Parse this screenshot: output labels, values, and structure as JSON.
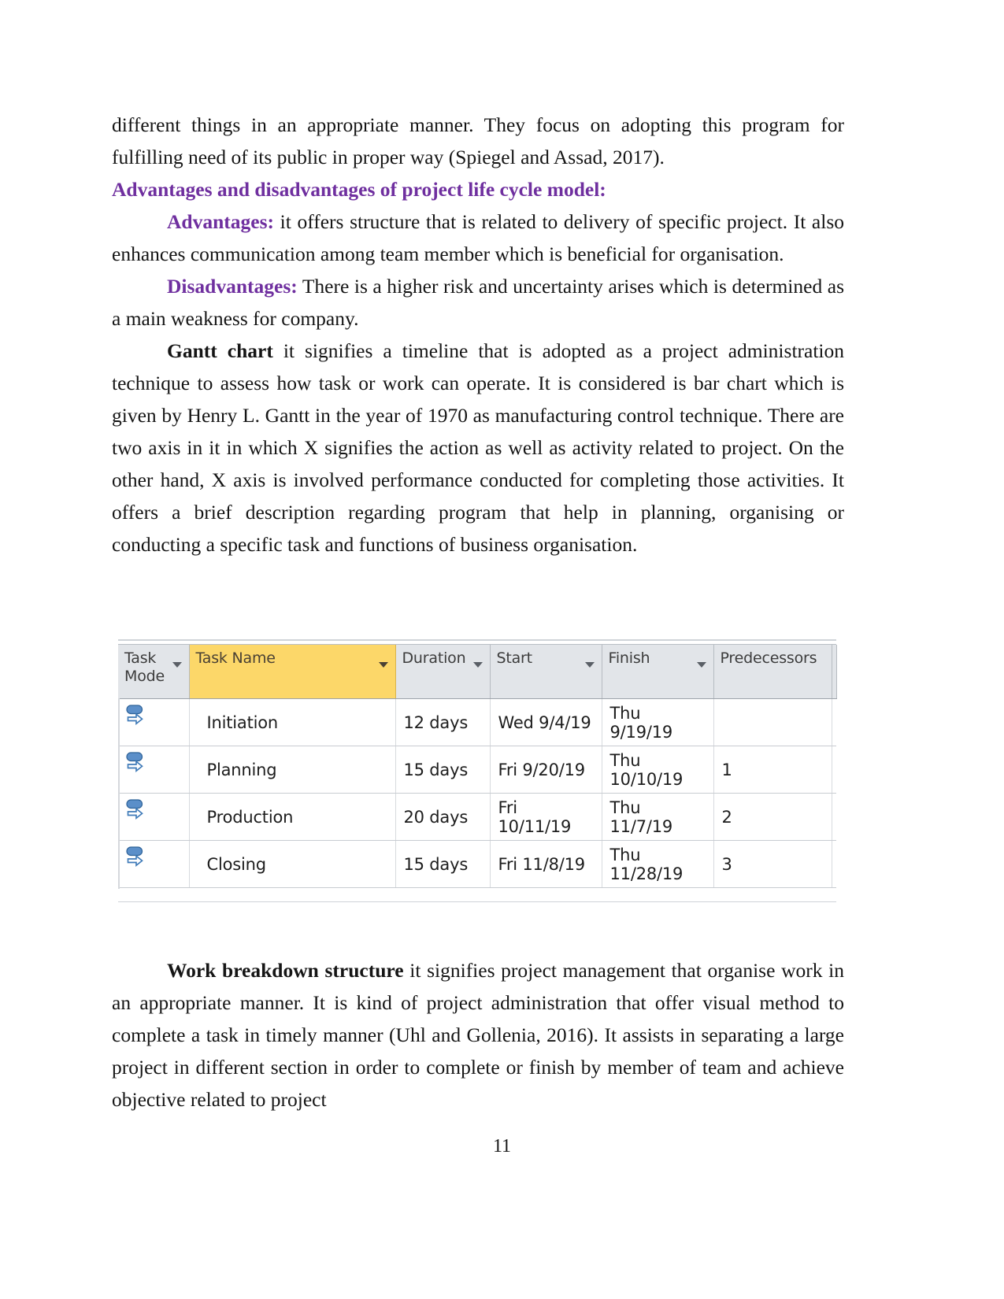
{
  "document": {
    "page_number": "11",
    "colors": {
      "heading_purple": "#6f2f9f",
      "body_purple": "#7a4fa8",
      "taskname_header_yellow": "#fcd769",
      "table_header_grey": "#e2e5e9"
    }
  },
  "body": {
    "para_1": "different things in an appropriate manner. They focus on adopting this program for fulfilling need of its public in proper way (Spiegel and Assad, 2017).",
    "heading_1": "Advantages and disadvantages of project life cycle model:",
    "advantages_label": "Advantages:",
    "advantages_text": " it offers structure that is related to delivery of specific project. It also enhances communication among team member which is beneficial for organisation.",
    "disadvantages_label": "Disadvantages:",
    "disadvantages_text": " There is a higher risk and uncertainty arises which is determined as a main weakness for company.",
    "gantt_label": "Gantt chart",
    "gantt_text": " it signifies a timeline that is adopted as a project administration technique to assess how task or work can operate. It is considered is bar chart which is given by Henry L. Gantt in the year of 1970 as manufacturing control technique. There are two axis in it in which X signifies the action as well as activity related to project. On the other hand, X axis is involved performance conducted for completing those activities. It offers a brief description regarding program that help in planning, organising or conducting a specific task and functions of business organisation.",
    "wbs_label": "Work breakdown structure",
    "wbs_text": " it signifies project management that organise work in an appropriate manner. It is kind of project administration that offer visual method to complete a task in timely manner (Uhl and Gollenia, 2016). It assists in separating a large project in different section in order to complete or finish by member of team and achieve objective related to project"
  },
  "project_table": {
    "columns": [
      {
        "id": "task_mode",
        "label": "Task Mode",
        "has_filter": true,
        "highlighted": false
      },
      {
        "id": "task_name",
        "label": "Task Name",
        "has_filter": true,
        "highlighted": true
      },
      {
        "id": "duration",
        "label": "Duration",
        "has_filter": true,
        "highlighted": false
      },
      {
        "id": "start",
        "label": "Start",
        "has_filter": true,
        "highlighted": false
      },
      {
        "id": "finish",
        "label": "Finish",
        "has_filter": true,
        "highlighted": false
      },
      {
        "id": "predecessors",
        "label": "Predecessors",
        "has_filter": true,
        "highlighted": false
      }
    ],
    "rows": [
      {
        "mode_icon": "manually-scheduled-icon",
        "task_name": "Initiation",
        "duration": "12 days",
        "start": "Wed 9/4/19",
        "finish": "Thu 9/19/19",
        "predecessors": ""
      },
      {
        "mode_icon": "manually-scheduled-icon",
        "task_name": "Planning",
        "duration": "15 days",
        "start": "Fri 9/20/19",
        "finish": "Thu 10/10/19",
        "predecessors": "1"
      },
      {
        "mode_icon": "manually-scheduled-icon",
        "task_name": "Production",
        "duration": "20 days",
        "start": "Fri 10/11/19",
        "finish": "Thu 11/7/19",
        "predecessors": "2"
      },
      {
        "mode_icon": "manually-scheduled-icon",
        "task_name": "Closing",
        "duration": "15 days",
        "start": "Fri 11/8/19",
        "finish": "Thu 11/28/19",
        "predecessors": "3"
      }
    ]
  }
}
